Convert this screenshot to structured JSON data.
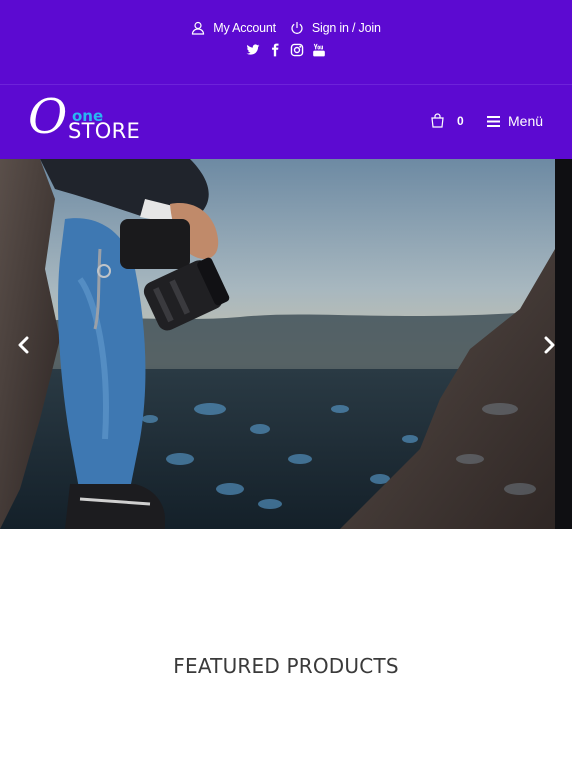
{
  "topbar": {
    "account_label": "My Account",
    "signin_label": "Sign in / Join",
    "socials": [
      "twitter-icon",
      "facebook-icon",
      "instagram-icon",
      "youtube-icon"
    ]
  },
  "header": {
    "logo": {
      "script_letter": "O",
      "one": "one",
      "store": "STORE"
    },
    "cart_count": "0",
    "menu_label": "Menü"
  },
  "slider": {
    "prev_icon": "chevron-left-icon",
    "next_icon": "chevron-right-icon"
  },
  "featured": {
    "title": "FEATURED PRODUCTS"
  },
  "colors": {
    "brand_purple": "#5c0ad1",
    "logo_accent": "#29b7f2",
    "text_white": "#ffffff",
    "heading_text": "#3a3a3a"
  }
}
